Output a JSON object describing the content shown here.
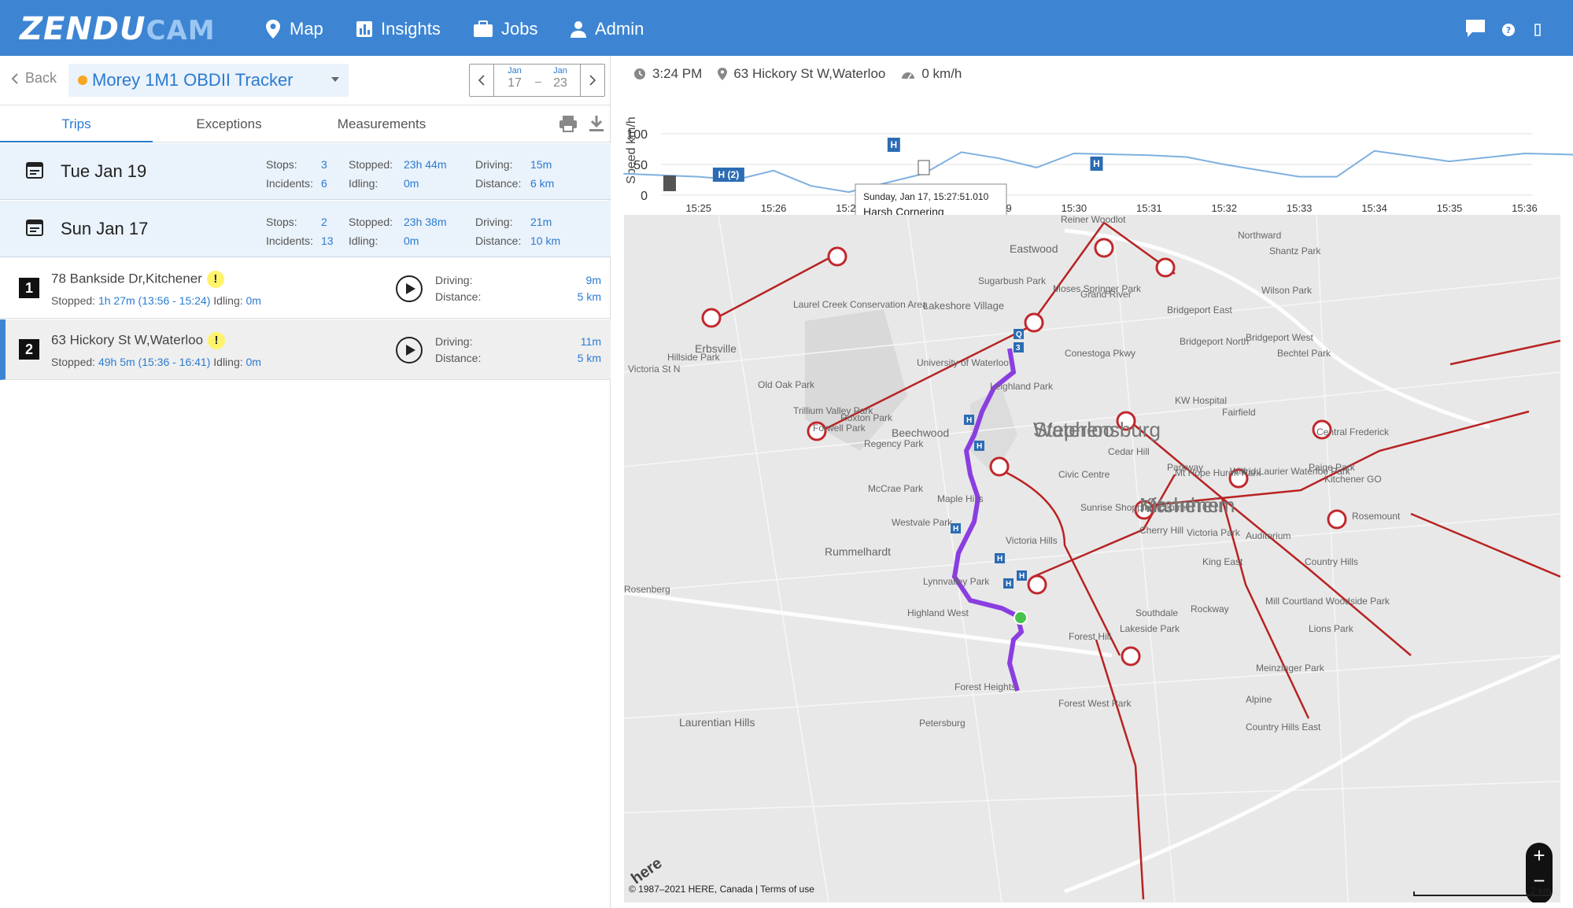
{
  "nav": {
    "logo_a": "ZENDU",
    "logo_b": "CAM",
    "items": [
      {
        "label": "Map",
        "icon": "pin-icon"
      },
      {
        "label": "Insights",
        "icon": "chart-icon"
      },
      {
        "label": "Jobs",
        "icon": "briefcase-icon"
      },
      {
        "label": "Admin",
        "icon": "user-icon"
      }
    ]
  },
  "header": {
    "back_label": "Back",
    "tracker_name": "Morey 1M1 OBDII Tracker",
    "date_from_month": "Jan",
    "date_from_day": "17",
    "date_to_month": "Jan",
    "date_to_day": "23",
    "date_dash": "–"
  },
  "tabs": [
    {
      "label": "Trips",
      "active": true
    },
    {
      "label": "Exceptions",
      "active": false
    },
    {
      "label": "Measurements",
      "active": false
    }
  ],
  "days": [
    {
      "title": "Tue Jan 19",
      "stops_k": "Stops:",
      "stops": "3",
      "incidents_k": "Incidents:",
      "incidents": "6",
      "stopped_k": "Stopped:",
      "stopped": "23h 44m",
      "idling_k": "Idling:",
      "idling": "0m",
      "driving_k": "Driving:",
      "driving": "15m",
      "distance_k": "Distance:",
      "distance": "6 km"
    },
    {
      "title": "Sun Jan 17",
      "stops_k": "Stops:",
      "stops": "2",
      "incidents_k": "Incidents:",
      "incidents": "13",
      "stopped_k": "Stopped:",
      "stopped": "23h 38m",
      "idling_k": "Idling:",
      "idling": "0m",
      "driving_k": "Driving:",
      "driving": "21m",
      "distance_k": "Distance:",
      "distance": "10 km"
    }
  ],
  "trips": [
    {
      "num": "1",
      "address": "78 Bankside Dr,Kitchener",
      "warn": "!",
      "stopped_k": "Stopped:",
      "stopped": "1h 27m (13:56 - 15:24)",
      "idling_k": "Idling:",
      "idling": "0m",
      "driving_k": "Driving:",
      "driving": "9m",
      "distance_k": "Distance:",
      "distance": "5 km"
    },
    {
      "num": "2",
      "address": "63 Hickory St W,Waterloo",
      "warn": "!",
      "stopped_k": "Stopped:",
      "stopped": "49h 5m (15:36 - 16:41)",
      "idling_k": "Idling:",
      "idling": "0m",
      "driving_k": "Driving:",
      "driving": "11m",
      "distance_k": "Distance:",
      "distance": "5 km"
    }
  ],
  "status": {
    "time": "3:24 PM",
    "address": "63 Hickory St W,Waterloo",
    "speed": "0 km/h"
  },
  "chart_data": {
    "type": "line",
    "ylabel": "Speed km/h",
    "ylim": [
      0,
      100
    ],
    "yticks": [
      "0",
      "50",
      "100"
    ],
    "xticks": [
      "15:25",
      "15:26",
      "15:27",
      "15:28",
      "15:29",
      "15:30",
      "15:31",
      "15:32",
      "15:33",
      "15:34",
      "15:35",
      "15:36"
    ],
    "series": [
      {
        "x": [
          15.24,
          15.25,
          15.255,
          15.26,
          15.265,
          15.27,
          15.28,
          15.285,
          15.29,
          15.295,
          15.3,
          15.31,
          15.315,
          15.32,
          15.33,
          15.335,
          15.34,
          15.35,
          15.36,
          15.37,
          15.375,
          15.38,
          15.39,
          15.4,
          15.41,
          15.42,
          15.43,
          15.44,
          15.45,
          15.46,
          15.47,
          15.48,
          15.49,
          15.5,
          15.51,
          15.52,
          15.53,
          15.54,
          15.55,
          15.56,
          15.57,
          15.58,
          15.59,
          15.6
        ],
        "values": [
          35,
          30,
          25,
          40,
          15,
          5,
          35,
          70,
          60,
          45,
          68,
          65,
          62,
          50,
          30,
          30,
          72,
          55,
          68,
          65,
          60,
          68,
          20,
          10,
          18,
          60,
          68,
          66,
          20,
          10,
          40,
          12,
          15,
          55,
          50,
          48,
          50,
          45,
          48,
          48,
          40,
          15,
          45,
          40
        ]
      }
    ],
    "tooltip": {
      "line1": "Sunday, Jan 17, 15:27:51.010",
      "line2": "Harsh Cornering"
    },
    "markers": [
      {
        "label": "H (2)"
      },
      {
        "label": "H"
      },
      {
        "label": "H"
      },
      {
        "label": "H"
      },
      {
        "label": "H (2)"
      },
      {
        "label": "H"
      },
      {
        "label": "Q"
      }
    ]
  },
  "map": {
    "attribution": "© 1987–2021 HERE, Canada | Terms of use",
    "scale": "2 km",
    "zoom_in": "+",
    "zoom_out": "−",
    "here_logo": "here",
    "labels": [
      "Waterloo",
      "Kitchener",
      "Erbsville",
      "Beechwood",
      "Rummelhardt",
      "Lakeshore Village",
      "University of Waterloo",
      "Laurel Creek Conservation Area",
      "Sugarbush Park",
      "Old Oak Park",
      "Trillium Valley Park",
      "Roxton Park",
      "Regency Park",
      "McCrae Park",
      "Westvale Park",
      "Maple Hills",
      "Victoria Hills",
      "Lynnvalley Park",
      "Highland West",
      "Forest Heights",
      "Forest Hill",
      "Laurentian Hills",
      "Petersburg",
      "Forest West Park",
      "Sunrise Shopping Centre",
      "Cherry Hill",
      "Victoria Park",
      "Cedar Hill",
      "Mt Hope Huron Park",
      "Civic Centre",
      "KW Hospital",
      "Fairfield",
      "Northward",
      "Bridgeport North",
      "Bridgeport West",
      "Bridgeport East",
      "Bechtel Park",
      "Paige Park",
      "Rosemount",
      "Auditorium",
      "King East",
      "Mill Courtland Woodside Park",
      "Rockway",
      "Southdale",
      "Lakeside Park",
      "Meinzinger Park",
      "Alpine",
      "Country Hills East",
      "Country Hills",
      "Lions Park",
      "Eastwood",
      "Wilson Park",
      "Conestoga Pkwy",
      "Grand River",
      "Moses Springer Park",
      "Hillside Park",
      "Forwell Park",
      "Reiner Woodlot",
      "Leighland Park",
      "Parkway",
      "Wilfrid Laurier Waterloo Park",
      "Kitchener GO",
      "Central Frederick",
      "Shantz Park",
      "Victoria St N",
      "Rosenberg",
      "Stephensburg",
      "Mannheim"
    ]
  }
}
